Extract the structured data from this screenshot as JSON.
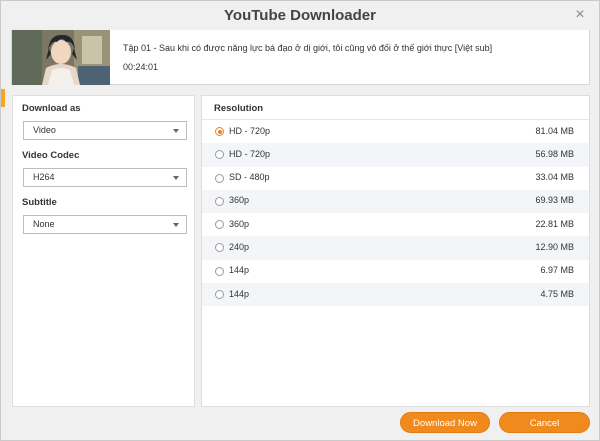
{
  "window": {
    "title": "YouTube Downloader",
    "close_symbol": "×"
  },
  "video": {
    "title": "Tập 01 - Sau khi có được năng lực bá đạo ở dị giới, tôi cũng vô đối ở thế giới thực [Việt sub]",
    "duration": "00:24:01"
  },
  "options": {
    "download_as": {
      "label": "Download as",
      "value": "Video"
    },
    "video_codec": {
      "label": "Video Codec",
      "value": "H264"
    },
    "subtitle": {
      "label": "Subtitle",
      "value": "None"
    }
  },
  "resolutions": {
    "header": "Resolution",
    "selected_index": 0,
    "items": [
      {
        "label": "HD - 720p",
        "size": "81.04 MB"
      },
      {
        "label": "HD - 720p",
        "size": "56.98 MB"
      },
      {
        "label": "SD - 480p",
        "size": "33.04 MB"
      },
      {
        "label": "360p",
        "size": "69.93 MB"
      },
      {
        "label": "360p",
        "size": "22.81 MB"
      },
      {
        "label": "240p",
        "size": "12.90 MB"
      },
      {
        "label": "144p",
        "size": "6.97 MB"
      },
      {
        "label": "144p",
        "size": "4.75 MB"
      }
    ]
  },
  "buttons": {
    "download": "Download Now",
    "cancel": "Cancel"
  },
  "colors": {
    "accent": "#f08a1c",
    "radio_checked": "#e8832a"
  }
}
